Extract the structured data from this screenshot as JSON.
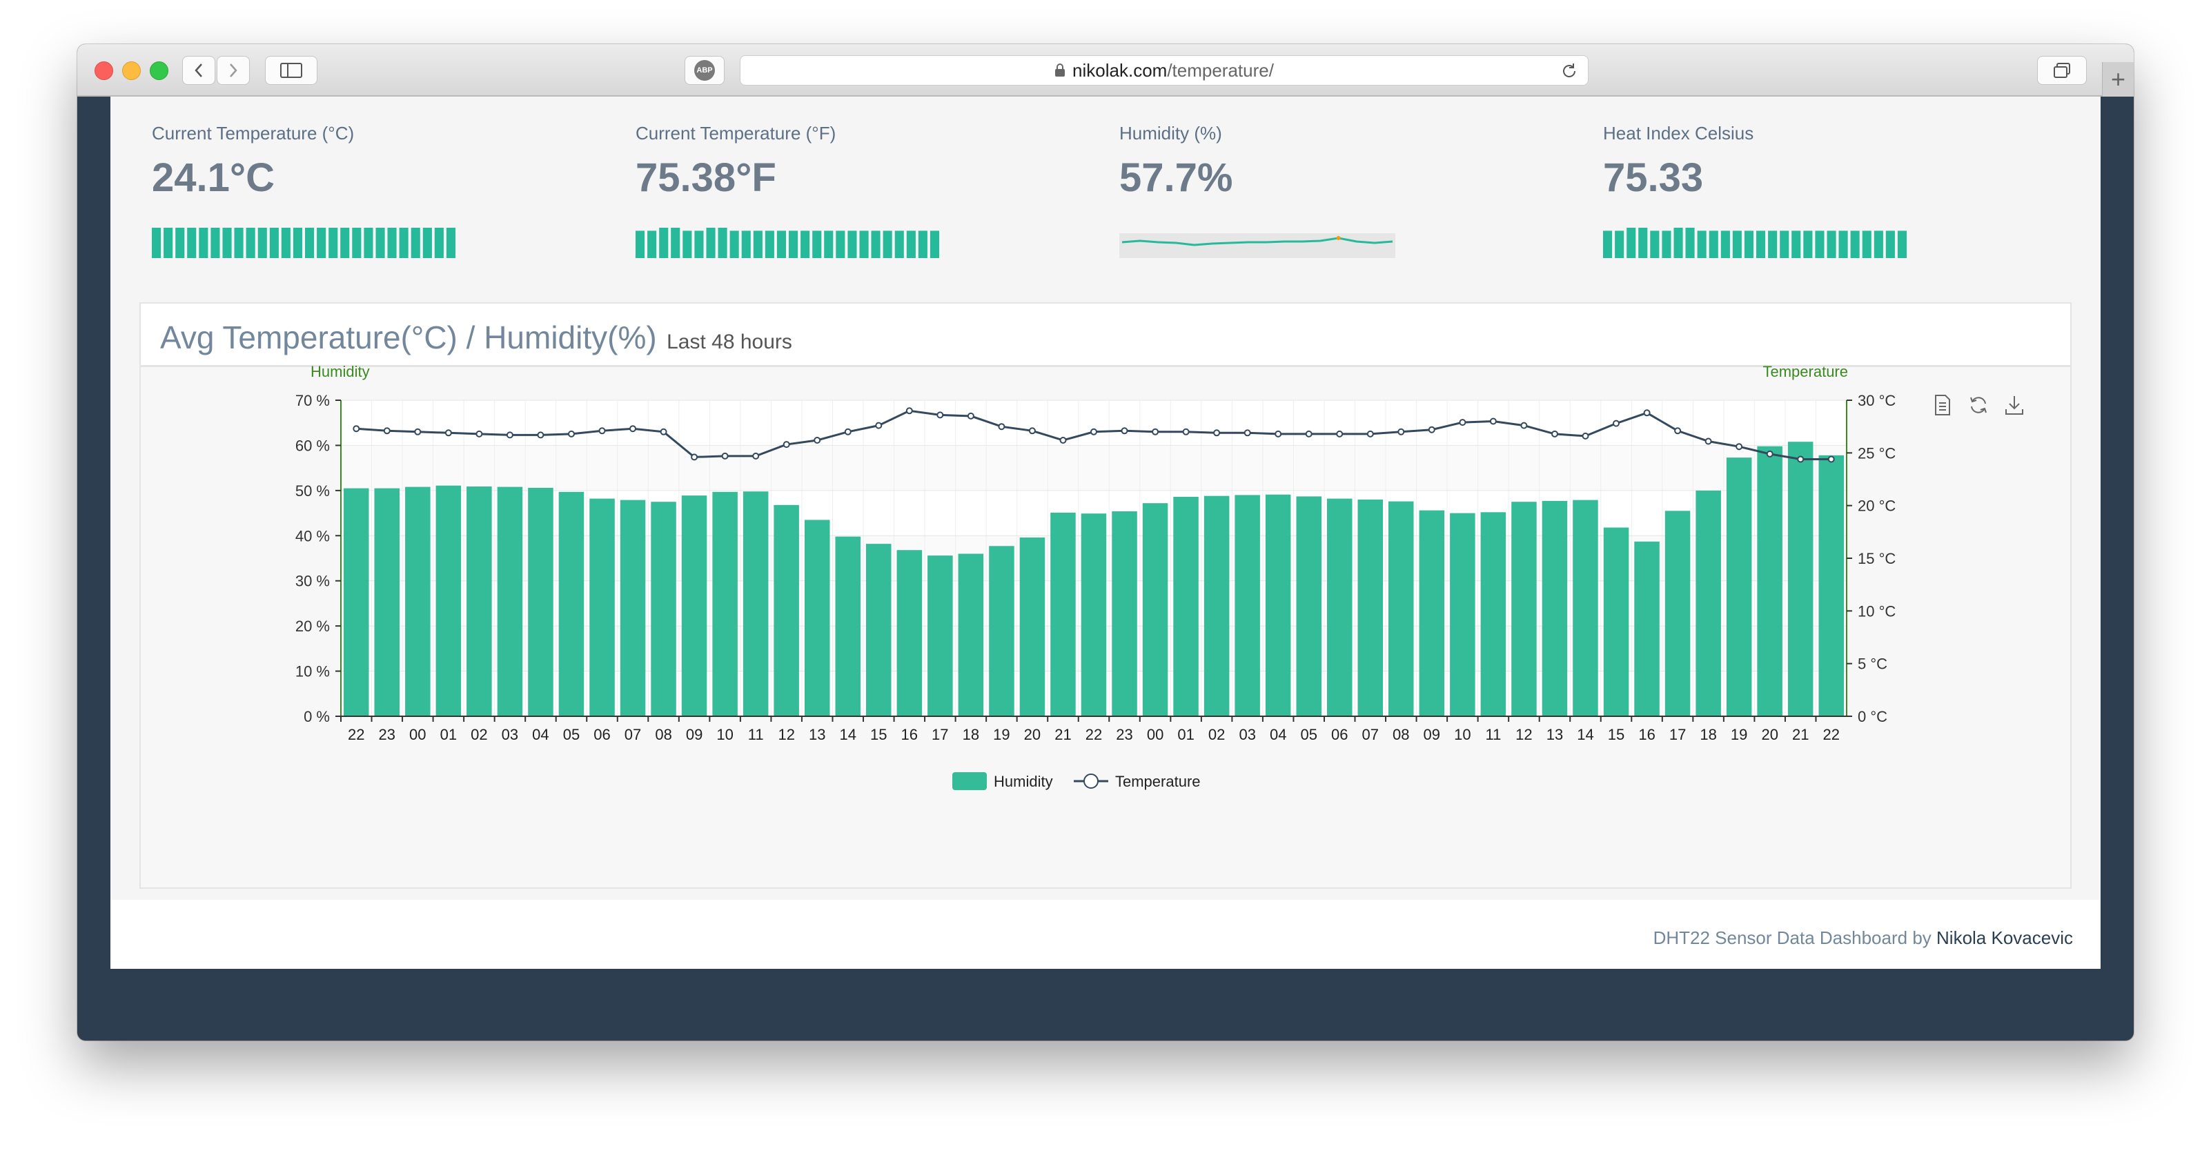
{
  "browser": {
    "url_host": "nikolak.com",
    "url_path": "/temperature/",
    "adblock_label": "ABP"
  },
  "stats": [
    {
      "label": "Current Temperature (°C)",
      "value": "24.1°C",
      "sparkline_type": "bar"
    },
    {
      "label": "Current Temperature (°F)",
      "value": "75.38°F",
      "sparkline_type": "bar"
    },
    {
      "label": "Humidity (%)",
      "value": "57.7%",
      "sparkline_type": "line"
    },
    {
      "label": "Heat Index Celsius",
      "value": "75.33",
      "sparkline_type": "bar"
    }
  ],
  "panel": {
    "title": "Avg Temperature(°C) / Humidity(%)",
    "subtitle": "Last 48 hours"
  },
  "chart_data": {
    "type": "bar",
    "categories": [
      "22",
      "23",
      "00",
      "01",
      "02",
      "03",
      "04",
      "05",
      "06",
      "07",
      "08",
      "09",
      "10",
      "11",
      "12",
      "13",
      "14",
      "15",
      "16",
      "17",
      "18",
      "19",
      "20",
      "21",
      "22",
      "23",
      "00",
      "01",
      "02",
      "03",
      "04",
      "05",
      "06",
      "07",
      "08",
      "09",
      "10",
      "11",
      "12",
      "13",
      "14",
      "15",
      "16",
      "17",
      "18",
      "19",
      "20",
      "21",
      "22"
    ],
    "series": [
      {
        "name": "Humidity",
        "type": "bar",
        "axis": "left",
        "values": [
          50.5,
          50.5,
          50.8,
          51.1,
          50.9,
          50.8,
          50.6,
          49.7,
          48.2,
          47.9,
          47.5,
          48.9,
          49.7,
          49.8,
          46.8,
          43.5,
          39.8,
          38.2,
          36.8,
          35.6,
          36.0,
          37.7,
          39.6,
          45.1,
          44.9,
          45.4,
          47.2,
          48.6,
          48.8,
          49.0,
          49.1,
          48.7,
          48.2,
          48.0,
          47.6,
          45.6,
          45.0,
          45.2,
          47.5,
          47.7,
          47.9,
          41.8,
          38.7,
          45.5,
          50.0,
          57.3,
          59.8,
          60.8,
          57.8
        ]
      },
      {
        "name": "Temperature",
        "type": "line",
        "axis": "right",
        "values": [
          27.3,
          27.1,
          27.0,
          26.9,
          26.8,
          26.7,
          26.7,
          26.8,
          27.1,
          27.3,
          27.0,
          24.6,
          24.7,
          24.7,
          25.8,
          26.2,
          27.0,
          27.6,
          29.0,
          28.6,
          28.5,
          27.5,
          27.1,
          26.2,
          27.0,
          27.1,
          27.0,
          27.0,
          26.9,
          26.9,
          26.8,
          26.8,
          26.8,
          26.8,
          27.0,
          27.2,
          27.9,
          28.0,
          27.6,
          26.8,
          26.6,
          27.8,
          28.8,
          27.1,
          26.1,
          25.6,
          24.9,
          24.4,
          24.4
        ]
      }
    ],
    "ylabel_left": "Humidity",
    "ylabel_right": "Temperature",
    "ylim_left": [
      0,
      70
    ],
    "ylim_right": [
      0,
      30
    ],
    "yticks_left": [
      "0 %",
      "10 %",
      "20 %",
      "30 %",
      "40 %",
      "50 %",
      "60 %",
      "70 %"
    ],
    "yticks_right": [
      "0 °C",
      "5 °C",
      "10 °C",
      "15 °C",
      "20 °C",
      "25 °C",
      "30 °C"
    ],
    "legend": [
      "Humidity",
      "Temperature"
    ],
    "legend_position": "bottom-center",
    "grid": true,
    "colors": {
      "bar": "#34bb97",
      "line": "#34495e",
      "axis_label": "#3a8a1f"
    }
  },
  "sparklines": {
    "bar_color": "#26b99a",
    "stat0": [
      9,
      9,
      9,
      9,
      9,
      9,
      9,
      9,
      9,
      9,
      9,
      9,
      9,
      9,
      9,
      9,
      9,
      9,
      9,
      9,
      9,
      9,
      9,
      9,
      9,
      9
    ],
    "stat1": [
      9,
      9,
      10,
      10,
      9,
      9,
      10,
      10,
      9,
      9,
      9,
      9,
      9,
      9,
      9,
      9,
      9,
      9,
      9,
      9,
      9,
      9,
      9,
      9,
      9,
      9
    ],
    "stat2": [
      57.6,
      57.8,
      57.6,
      57.5,
      57.2,
      57.4,
      57.5,
      57.6,
      57.6,
      57.7,
      57.7,
      57.8,
      58.2,
      57.7,
      57.5,
      57.7
    ],
    "stat3": [
      9,
      9,
      10,
      10,
      9,
      9,
      10,
      10,
      9,
      9,
      9,
      9,
      9,
      9,
      9,
      9,
      9,
      9,
      9,
      9,
      9,
      9,
      9,
      9,
      9,
      9
    ]
  },
  "toolbox": [
    "data-view-icon",
    "restore-icon",
    "save-image-icon"
  ],
  "footer": {
    "text": "DHT22 Sensor Data Dashboard by",
    "author": "Nikola Kovacevic"
  }
}
